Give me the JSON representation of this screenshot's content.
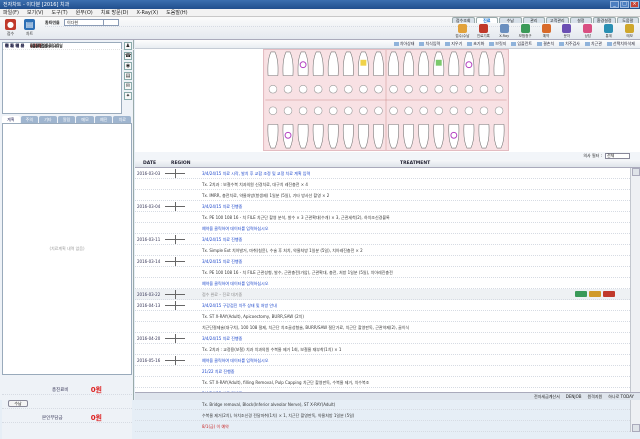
{
  "title": "전자차트 - 이다분 [2016] 치과",
  "window": {
    "min": "_",
    "max": "□",
    "close": "×"
  },
  "menu": [
    "파일(F)",
    "보기(V)",
    "도구(T)",
    "원무(O)",
    "치료 방문(D)",
    "X-Ray(X)",
    "도움말(H)"
  ],
  "left_buttons": [
    {
      "label": "접수",
      "icon": "reception-icon",
      "color": "#c0392b"
    },
    {
      "label": "차트",
      "icon": "chart-icon",
      "color": "#2c6fb5"
    }
  ],
  "search": {
    "label1": "차트번호",
    "value1": "",
    "label2": "환자이름",
    "value2": "이다현"
  },
  "tabs": [
    "접수조회",
    "진료",
    "수납",
    "관리",
    "고객관리",
    "설정",
    "환경설정",
    "도움말"
  ],
  "active_tab": 1,
  "app_icons": [
    {
      "label": "접수/수납",
      "color": "#e2a23b"
    },
    {
      "label": "진료기록",
      "color": "#c0392b"
    },
    {
      "label": "X-Ray",
      "color": "#6a8fbf"
    },
    {
      "label": "보험청구",
      "color": "#3a9a59"
    },
    {
      "label": "예약",
      "color": "#d86a2a"
    },
    {
      "label": "문자",
      "color": "#6b4fb3"
    },
    {
      "label": "상담",
      "color": "#d94f82"
    },
    {
      "label": "통계",
      "color": "#2a8fb3"
    },
    {
      "label": "메모",
      "color": "#cfa72c"
    }
  ],
  "patient": [
    {
      "k": "환 자 명",
      "v": "이다현(여)"
    },
    {
      "k": "나     이",
      "v": "30세(남)"
    },
    {
      "k": "환 자 구 분",
      "v": ""
    },
    {
      "k": "생     일",
      "v": "5월 27일(30세)"
    },
    {
      "k": "전 화 번 호",
      "v": "010-1234-5678"
    },
    {
      "k": "진 료 의 사",
      "v": "김원장",
      "red": true
    },
    {
      "k": "최 근 내 원",
      "v": "2016년 5월 16일"
    },
    {
      "k": "대 기 사 유",
      "v": "(없음)"
    },
    {
      "k": "메     모",
      "v": "(없음)"
    }
  ],
  "side_icons": [
    "person-icon",
    "phone-icon",
    "camera-icon",
    "document-icon",
    "sms-icon",
    "gift-icon"
  ],
  "memo_tabs": [
    "계획",
    "주의",
    "기타",
    "알림",
    "메모",
    "예진",
    "치료"
  ],
  "memo_placeholder": "(치료계획 내역 없음)",
  "money": {
    "total_label": "총진료비",
    "total_value": "0원",
    "button_label": "수납",
    "patient_label": "본인부담금",
    "patient_value": "0원"
  },
  "tooth_toolbar": [
    "치아상태",
    "치식입력",
    "지우기",
    "초기화",
    "브릿지",
    "임플란트",
    "결손치",
    "치주검사",
    "치근관",
    "선택치아삭제"
  ],
  "treat_label": "의사 필터 :",
  "treat_filter": "전체",
  "headers": {
    "date": "DATE",
    "region": "REGION",
    "treatment": "TREATMENT"
  },
  "rows": [
    {
      "date": "2016-03-03",
      "tx": "3/4/24/15 치료 시작, 발치 후 교합 조정 및 교정 치료 계획 입력",
      "cls": "blue"
    },
    {
      "date": "",
      "tx": "Tx. 2치과 : 보철수복  치과의원 신경치료, 대구치 레진충전 × 4",
      "bold": "Tx."
    },
    {
      "date": "",
      "tx": "Tx. IMRR,  충전치료, 약물처방(항생제) 1일분 (5일), 기타 방사선 촬영 × 2",
      "bold": "Tx."
    },
    {
      "date": "2016-03-04",
      "tx": "3/4/24/15 치료 진행중",
      "cls": "blue"
    },
    {
      "date": "",
      "tx": "Tx. PE   100 108 16 - 치 FILE 치근단 촬영 분석, 발수 × 3 근관확대(수개) × 3, 근관세척(2), 하치조신경블록",
      "bold": "Tx."
    },
    {
      "date": "",
      "tx": "예약을 클릭하여 데이터를 입력하십시오",
      "cls": "blue"
    },
    {
      "date": "2016-03-11",
      "tx": "3/4/24/15 치료 진행중",
      "cls": "blue"
    },
    {
      "date": "",
      "tx": "Tx. Simple Ext  치아발거, 마취(침윤), 수술 후 처치, 약물처방 1일분 (5일), 치아레진충전 × 2",
      "bold": "Tx."
    },
    {
      "date": "2016-03-14",
      "tx": "3/4/24/15 치료 진행중",
      "cls": "blue"
    },
    {
      "date": "",
      "tx": "Tx. PE   100 108 16 - 치 FILE 근관성형, 발수, 근관충전(가압), 근관확대, 충전, 처방 1일분 (5일), 치아레진충전",
      "bold": "Tx."
    },
    {
      "date": "",
      "tx": "예약을 클릭하여 데이터를 입력하십시오",
      "cls": "blue"
    },
    {
      "date": "2016-03-22",
      "tx": "접수 완료 – 진료 대기중",
      "cls": "gray",
      "gray": true,
      "pills": true
    },
    {
      "date": "2016-04-13",
      "tx": "3/4/24/15 구강검진 치주 상태 및 처방 안내",
      "cls": "blue"
    },
    {
      "date": "",
      "tx": "Tx. ST X-RAY(Adult), Apicoectomy, BURR,SAW (2치)",
      "bold": "Tx."
    },
    {
      "date": "",
      "tx": "치근단절제술(대구치), 100 108 절제, 치근단 치조골성형술, BURR/SAW 절단가료, 치근단 촬영판독, 근관약제(2), 골이식",
      "cls": ""
    },
    {
      "date": "2016-04-20",
      "tx": "3/4/24/15 치료 진행중",
      "cls": "blue"
    },
    {
      "date": "",
      "tx": "Tx. 2치과 : 교정용(보철) 치과   치과의원 수복물 제거 1회, 보철물 재부착(1치) × 1",
      "bold": "Tx."
    },
    {
      "date": "2016-05-16",
      "tx": "예약을 클릭하여 데이터를 입력하십시오",
      "cls": "blue"
    },
    {
      "date": "",
      "tx": "21/22 치료 진행중",
      "cls": "blue"
    },
    {
      "date": "",
      "tx": "Tx. ST X-RAY(Adult), filling Removal, Pulp Capping  치근단 촬영판독, 수복물 제거, 치수복조",
      "bold": "Tx."
    },
    {
      "date": "",
      "tx": "3/4/24/15 치료 진행중",
      "cls": "blue"
    },
    {
      "date": "",
      "tx": "Tx. Bridge removal, Block(Inferior alveolar Nerve), ST X-RAY(Adult)",
      "bold": "Tx."
    },
    {
      "date": "",
      "tx": "수복물 제거(2치), 하치조신경 전달마취(1치) × 1, 치근단 촬영판독, 약물처방 1일분 (5일)",
      "cls": ""
    },
    {
      "date": "",
      "tx": "8/1(금) 이 예약",
      "cls": "red"
    }
  ],
  "status": [
    "전자세금계산서",
    "DENJOB",
    "원격지원",
    "하나로 TODAY"
  ]
}
